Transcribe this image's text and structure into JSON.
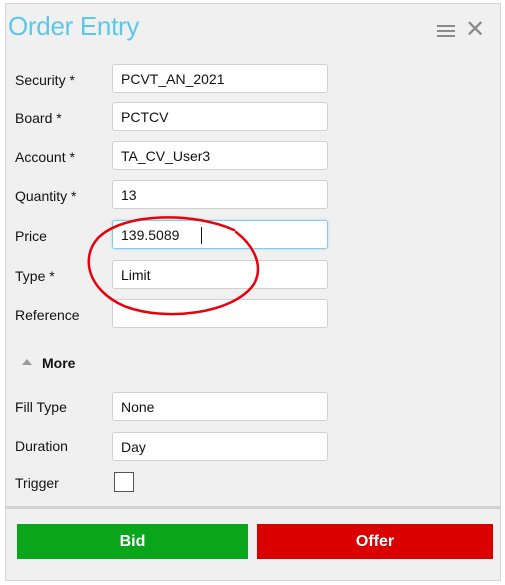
{
  "window": {
    "title": "Order Entry",
    "menu_icon": "hamburger-menu-icon",
    "close_icon": "close-x-icon"
  },
  "form": {
    "security": {
      "label": "Security *",
      "value": "PCVT_AN_2021"
    },
    "board": {
      "label": "Board *",
      "value": "PCTCV"
    },
    "account": {
      "label": "Account *",
      "value": "TA_CV_User3"
    },
    "quantity": {
      "label": "Quantity *",
      "value": "13"
    },
    "price": {
      "label": "Price",
      "value": "139.5089"
    },
    "type": {
      "label": "Type *",
      "value": "Limit"
    },
    "reference": {
      "label": "Reference",
      "value": ""
    }
  },
  "more": {
    "label": "More",
    "expanded": true,
    "fill_type": {
      "label": "Fill Type",
      "value": "None"
    },
    "duration": {
      "label": "Duration",
      "value": "Day"
    },
    "trigger": {
      "label": "Trigger",
      "checked": false
    }
  },
  "actions": {
    "bid_label": "Bid",
    "offer_label": "Offer"
  },
  "colors": {
    "title": "#5bc8ea",
    "bid": "#0aa51a",
    "offer": "#db0000",
    "annotation": "#e8000b"
  }
}
